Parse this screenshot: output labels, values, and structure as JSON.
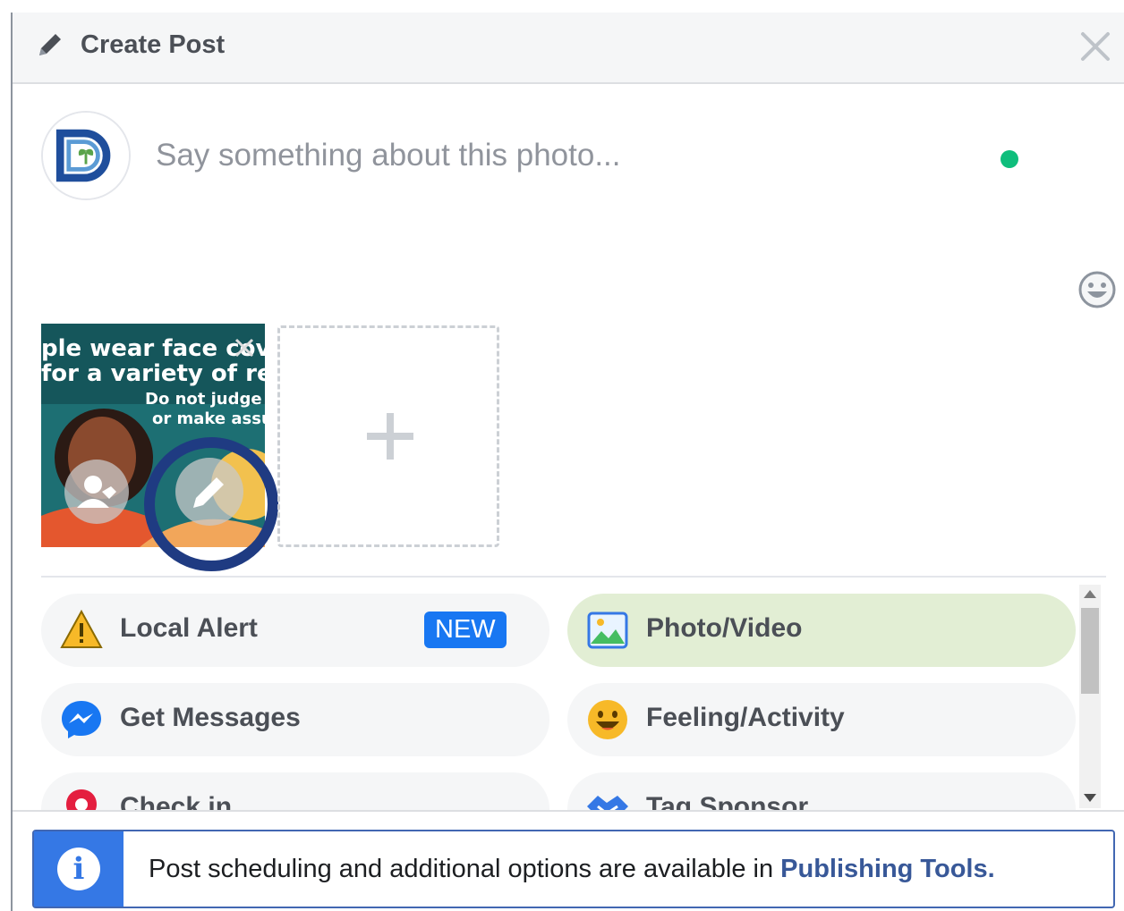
{
  "header": {
    "title": "Create Post",
    "icon": "pencil-icon",
    "close_icon": "close-icon"
  },
  "composer": {
    "placeholder": "Say something about this photo...",
    "value": "",
    "status_color": "#0fbe7c"
  },
  "attachment": {
    "thumbnail_lines": [
      "ple wear face cov",
      "for a variety of re",
      "Do not judge",
      "or make assu"
    ],
    "tag_icon": "tag-person-icon",
    "edit_icon": "pencil-icon",
    "add_icon": "plus-icon"
  },
  "options": [
    {
      "label": "Local Alert",
      "badge": "NEW",
      "icon": "warning-icon",
      "active": false
    },
    {
      "label": "Photo/Video",
      "icon": "photo-icon",
      "active": true
    },
    {
      "label": "Get Messages",
      "icon": "messenger-icon",
      "active": false
    },
    {
      "label": "Feeling/Activity",
      "icon": "smiley-icon",
      "active": false
    },
    {
      "label": "Check in",
      "icon": "location-pin-icon",
      "active": false
    },
    {
      "label": "Tag Sponsor",
      "icon": "handshake-icon",
      "active": false
    }
  ],
  "notice": {
    "text": "Post scheduling and additional options are available in ",
    "link": "Publishing Tools.",
    "icon": "info-icon"
  },
  "colors": {
    "accent": "#1877f2",
    "active_option": "#e2eed4",
    "highlight_ring": "#1f3b82",
    "notice_side": "#3578e5"
  }
}
